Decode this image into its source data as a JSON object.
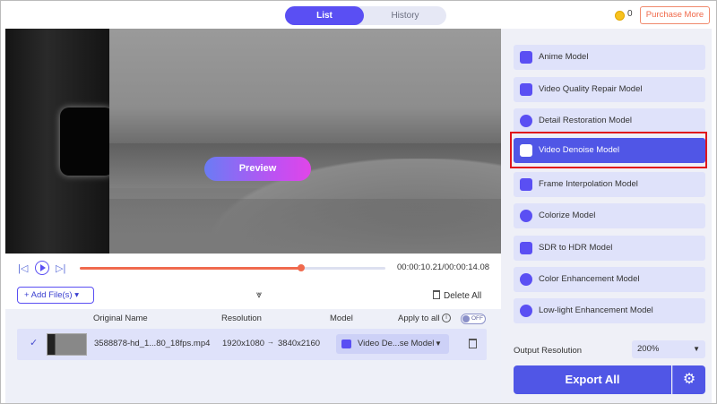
{
  "header": {
    "tabs": [
      {
        "label": "List",
        "active": true
      },
      {
        "label": "History",
        "active": false
      }
    ],
    "coins": "0",
    "purchase_label": "Purchase More"
  },
  "video": {
    "preview_label": "Preview"
  },
  "playback": {
    "time": "00:00:10.21/00:00:14.08",
    "progress_fraction": 0.725
  },
  "toolbar": {
    "add_files_label": "+ Add File(s) ▾",
    "delete_all_label": "Delete All"
  },
  "table": {
    "columns": [
      "Original Name",
      "Resolution",
      "Model",
      "Apply to all"
    ],
    "toggle_label": "OFF",
    "rows": [
      {
        "name": "3588878-hd_1...80_18fps.mp4",
        "res_from": "1920x1080",
        "res_to": "3840x2160",
        "model": "Video De...se Model"
      }
    ]
  },
  "models": {
    "items": [
      {
        "label": "Anime Model",
        "icon": "anime-icon"
      },
      {
        "label": "Video Quality Repair Model",
        "icon": "video-repair-icon"
      },
      {
        "label": "Detail Restoration Model",
        "icon": "detail-icon"
      },
      {
        "label": "Video Denoise Model",
        "icon": "denoise-icon",
        "active": true
      },
      {
        "label": "Frame Interpolation Model",
        "icon": "frame-interp-icon"
      },
      {
        "label": "Colorize Model",
        "icon": "colorize-icon"
      },
      {
        "label": "SDR to HDR Model",
        "icon": "hdr-icon"
      },
      {
        "label": "Color Enhancement Model",
        "icon": "palette-icon"
      },
      {
        "label": "Low-light Enhancement Model",
        "icon": "moon-icon"
      }
    ],
    "output_resolution_label": "Output Resolution",
    "output_resolution_value": "200%",
    "export_label": "Export All"
  },
  "colors": {
    "accent": "#5056e6",
    "highlight_border": "#e0161c",
    "progress": "#f06a4e"
  }
}
